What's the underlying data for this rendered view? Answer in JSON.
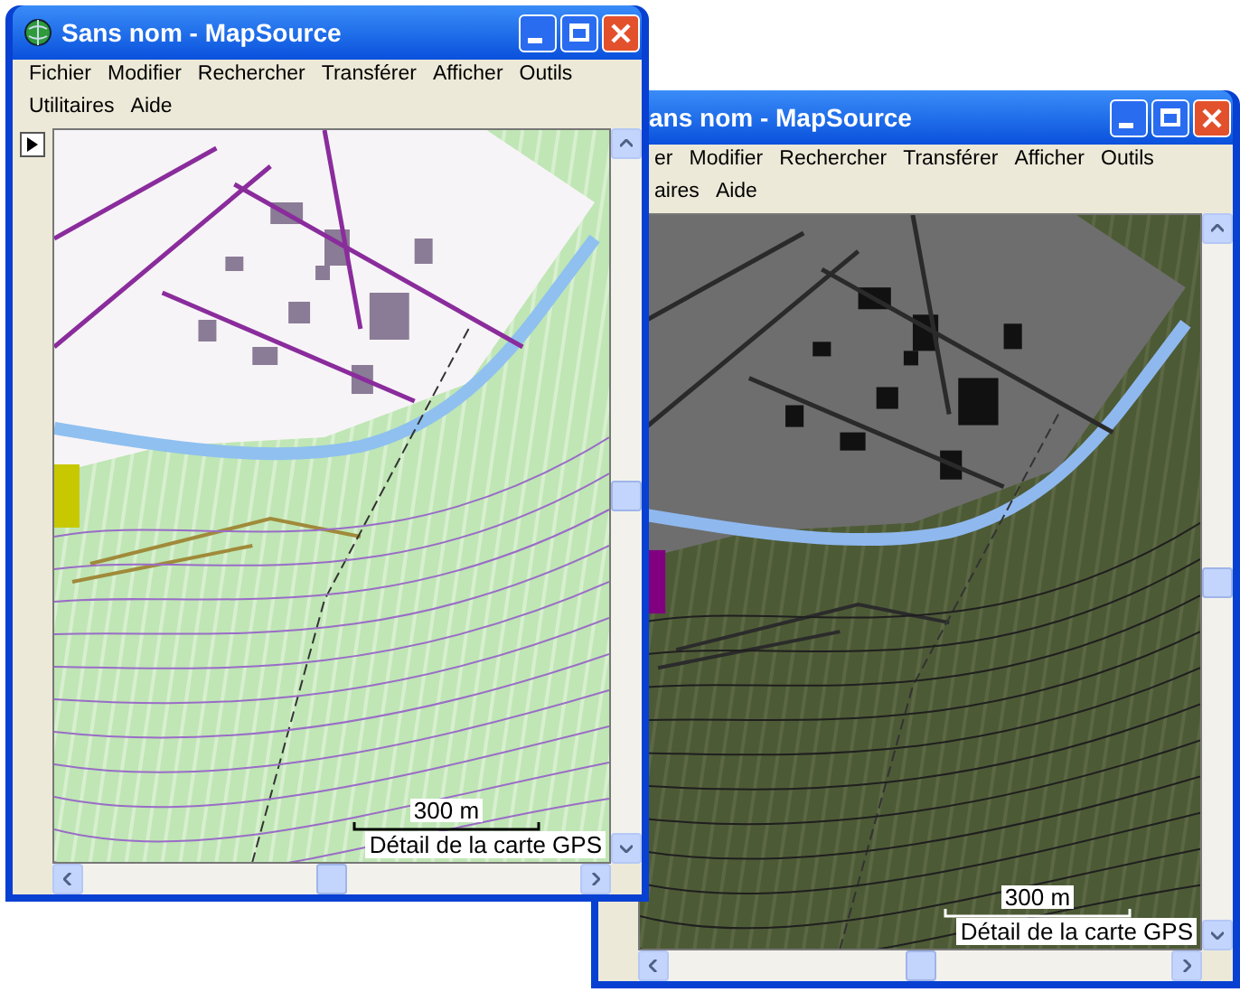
{
  "windows": [
    {
      "title": "Sans nom - MapSource",
      "show_app_icon": true,
      "menu_rows": [
        [
          "Fichier",
          "Modifier",
          "Rechercher",
          "Transférer",
          "Afficher",
          "Outils"
        ],
        [
          "Utilitaires",
          "Aide"
        ]
      ],
      "map": {
        "kind": "light",
        "scale": "300 m",
        "caption": "Détail de la carte GPS"
      }
    },
    {
      "title": "ans nom - MapSource",
      "show_app_icon": false,
      "menu_rows": [
        [
          "er",
          "Modifier",
          "Rechercher",
          "Transférer",
          "Afficher",
          "Outils"
        ],
        [
          "aires",
          "Aide"
        ]
      ],
      "map": {
        "kind": "dark",
        "scale": "300 m",
        "caption": "Détail de la carte GPS"
      }
    }
  ]
}
